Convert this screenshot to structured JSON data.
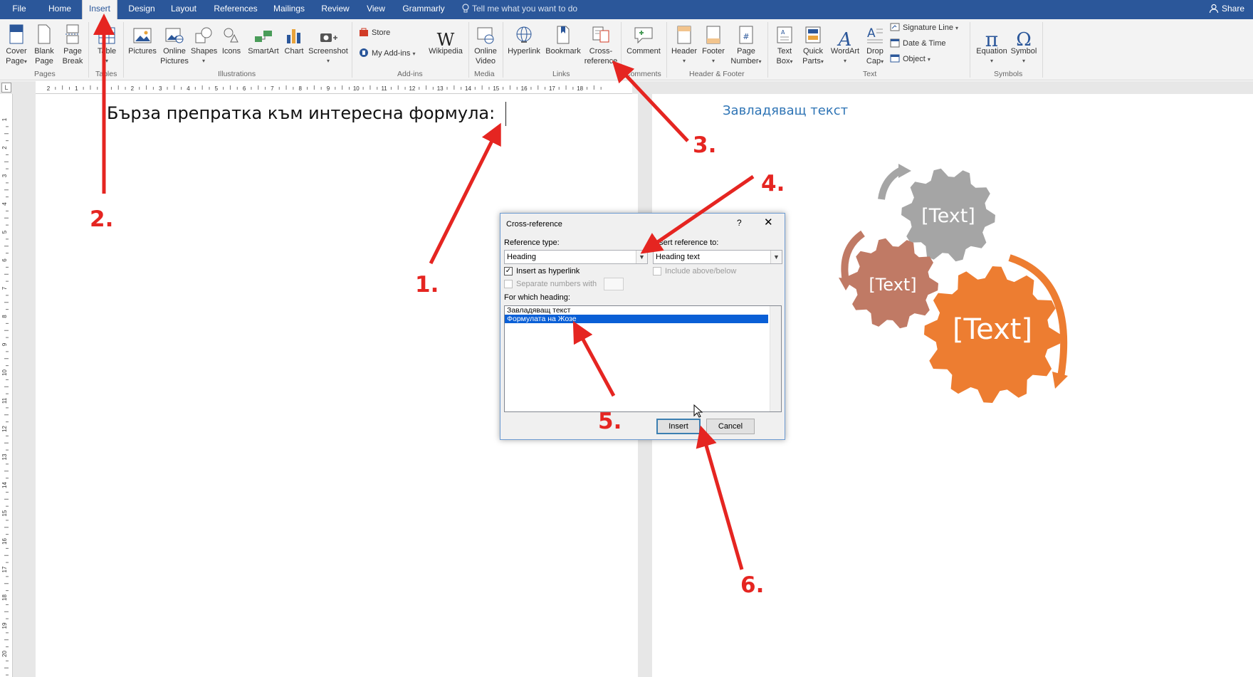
{
  "tabs": [
    {
      "label": "File"
    },
    {
      "label": "Home"
    },
    {
      "label": "Insert"
    },
    {
      "label": "Design"
    },
    {
      "label": "Layout"
    },
    {
      "label": "References"
    },
    {
      "label": "Mailings"
    },
    {
      "label": "Review"
    },
    {
      "label": "View"
    },
    {
      "label": "Grammarly"
    }
  ],
  "active_tab": "Insert",
  "tell_me": "Tell me what you want to do",
  "share": "Share",
  "ribbon": {
    "cover_page": [
      "Cover",
      "Page"
    ],
    "blank_page": [
      "Blank",
      "Page"
    ],
    "page_break": [
      "Page",
      "Break"
    ],
    "table": "Table",
    "pictures": "Pictures",
    "online_pictures": [
      "Online",
      "Pictures"
    ],
    "shapes": "Shapes",
    "icons": "Icons",
    "smartart": "SmartArt",
    "chart": "Chart",
    "screenshot": "Screenshot",
    "store": "Store",
    "my_addins": "My Add-ins",
    "wikipedia": "Wikipedia",
    "online_video": [
      "Online",
      "Video"
    ],
    "hyperlink": "Hyperlink",
    "bookmark": "Bookmark",
    "cross_reference": [
      "Cross-",
      "reference"
    ],
    "comment": "Comment",
    "header": "Header",
    "footer": "Footer",
    "page_number": [
      "Page",
      "Number"
    ],
    "text_box": [
      "Text",
      "Box"
    ],
    "quick_parts": [
      "Quick",
      "Parts"
    ],
    "wordart": "WordArt",
    "drop_cap": [
      "Drop",
      "Cap"
    ],
    "signature_line": "Signature Line",
    "date_time": "Date & Time",
    "object": "Object",
    "equation": "Equation",
    "symbol": "Symbol",
    "groups": {
      "pages": "Pages",
      "tables": "Tables",
      "illustrations": "Illustrations",
      "addins": "Add-ins",
      "media": "Media",
      "links": "Links",
      "comments": "Comments",
      "header_footer": "Header & Footer",
      "text": "Text",
      "symbols": "Symbols"
    }
  },
  "ruler_numbers": [
    "2",
    "1",
    "1",
    "2",
    "3",
    "4",
    "5",
    "6",
    "7",
    "8",
    "9",
    "10",
    "11",
    "12",
    "13",
    "14",
    "15",
    "16",
    "17",
    "18"
  ],
  "left_ruler_numbers": [
    "1",
    "2",
    "3",
    "4",
    "5",
    "6",
    "7",
    "8",
    "9",
    "10",
    "11",
    "12",
    "13",
    "14",
    "15",
    "16",
    "17",
    "18",
    "19",
    "20"
  ],
  "document": {
    "text": "Бърза препратка към интересна формула:",
    "page2_heading": "Завладяващ текст"
  },
  "dialog": {
    "title": "Cross-reference",
    "help": "?",
    "close": "✕",
    "reference_type_label": "Reference type:",
    "reference_type_value": "Heading",
    "insert_reference_label": "Insert reference to:",
    "insert_reference_value": "Heading text",
    "insert_hyperlink_label": "Insert as hyperlink",
    "insert_hyperlink_checked": true,
    "include_above_below_label": "Include above/below",
    "separate_numbers_label": "Separate numbers with",
    "for_which_label": "For which heading:",
    "headings": [
      "Завладяващ текст",
      "Формулата на Жозе"
    ],
    "selected_index": 1,
    "insert_button": "Insert",
    "cancel_button": "Cancel"
  },
  "annotations": [
    "1.",
    "2.",
    "3.",
    "4.",
    "5.",
    "6."
  ],
  "annotation_color": "#e52521",
  "smartart": {
    "labels": [
      "[Text]",
      "[Text]",
      "[Text]"
    ],
    "colors": [
      "#a5a5a5",
      "#c07a65",
      "#ed7d31"
    ]
  }
}
